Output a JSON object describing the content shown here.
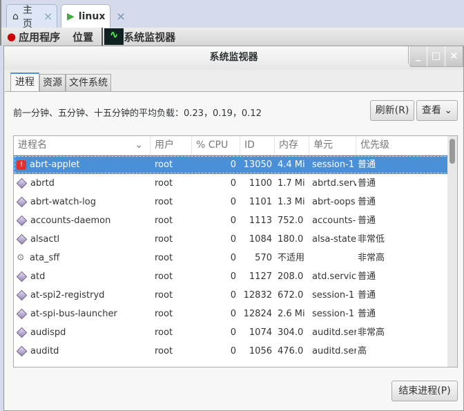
{
  "browser_tabs": [
    {
      "label": "主页",
      "icon": "home-icon"
    },
    {
      "label": "linux",
      "icon": "terminal-icon"
    }
  ],
  "panel": {
    "applications": "应用程序",
    "places": "位置",
    "task": "系统监视器"
  },
  "window": {
    "title": "系统监视器",
    "minimize": "_",
    "maximize": "□",
    "close": "×"
  },
  "tabs": [
    "进程",
    "资源",
    "文件系统"
  ],
  "load_text": "前一分钟、五分钟、十五分钟的平均负载：0.23，0.19，0.12",
  "refresh_label": "刷新(R)",
  "view_label": "查看",
  "end_process_label": "结束进程(P)",
  "columns": [
    "进程名",
    "用户",
    "% CPU",
    "ID",
    "内存",
    "单元",
    "优先级"
  ],
  "rows": [
    {
      "name": "abrt-applet",
      "user": "root",
      "cpu": "0",
      "id": "13050",
      "mem": "4.4 Mi",
      "unit": "session-1",
      "prio": "普通",
      "icon": "alert-icon",
      "selected": true
    },
    {
      "name": "abrtd",
      "user": "root",
      "cpu": "0",
      "id": "1100",
      "mem": "1.7 Mi",
      "unit": "abrtd.serv",
      "prio": "普通",
      "icon": "process-icon"
    },
    {
      "name": "abrt-watch-log",
      "user": "root",
      "cpu": "0",
      "id": "1101",
      "mem": "1.3 Mi",
      "unit": "abrt-oops",
      "prio": "普通",
      "icon": "process-icon"
    },
    {
      "name": "accounts-daemon",
      "user": "root",
      "cpu": "0",
      "id": "1113",
      "mem": "752.0",
      "unit": "accounts-",
      "prio": "普通",
      "icon": "process-icon"
    },
    {
      "name": "alsactl",
      "user": "root",
      "cpu": "0",
      "id": "1084",
      "mem": "180.0",
      "unit": "alsa-state",
      "prio": "非常低",
      "icon": "process-icon"
    },
    {
      "name": "ata_sff",
      "user": "root",
      "cpu": "0",
      "id": "570",
      "mem": "不适用",
      "unit": "",
      "prio": "非常高",
      "icon": "gear-icon"
    },
    {
      "name": "atd",
      "user": "root",
      "cpu": "0",
      "id": "1127",
      "mem": "208.0",
      "unit": "atd.servic",
      "prio": "普通",
      "icon": "process-icon"
    },
    {
      "name": "at-spi2-registryd",
      "user": "root",
      "cpu": "0",
      "id": "12832",
      "mem": "672.0",
      "unit": "session-1",
      "prio": "普通",
      "icon": "process-icon"
    },
    {
      "name": "at-spi-bus-launcher",
      "user": "root",
      "cpu": "0",
      "id": "12824",
      "mem": "2.6 Mi",
      "unit": "session-1",
      "prio": "普通",
      "icon": "process-icon"
    },
    {
      "name": "audispd",
      "user": "root",
      "cpu": "0",
      "id": "1074",
      "mem": "304.0",
      "unit": "auditd.ser",
      "prio": "非常高",
      "icon": "process-icon"
    },
    {
      "name": "auditd",
      "user": "root",
      "cpu": "0",
      "id": "1056",
      "mem": "476.0",
      "unit": "auditd.ser",
      "prio": "高",
      "icon": "process-icon"
    }
  ],
  "colors": {
    "selection": "#4a90d9",
    "tabbar": "#d5dbeb"
  }
}
